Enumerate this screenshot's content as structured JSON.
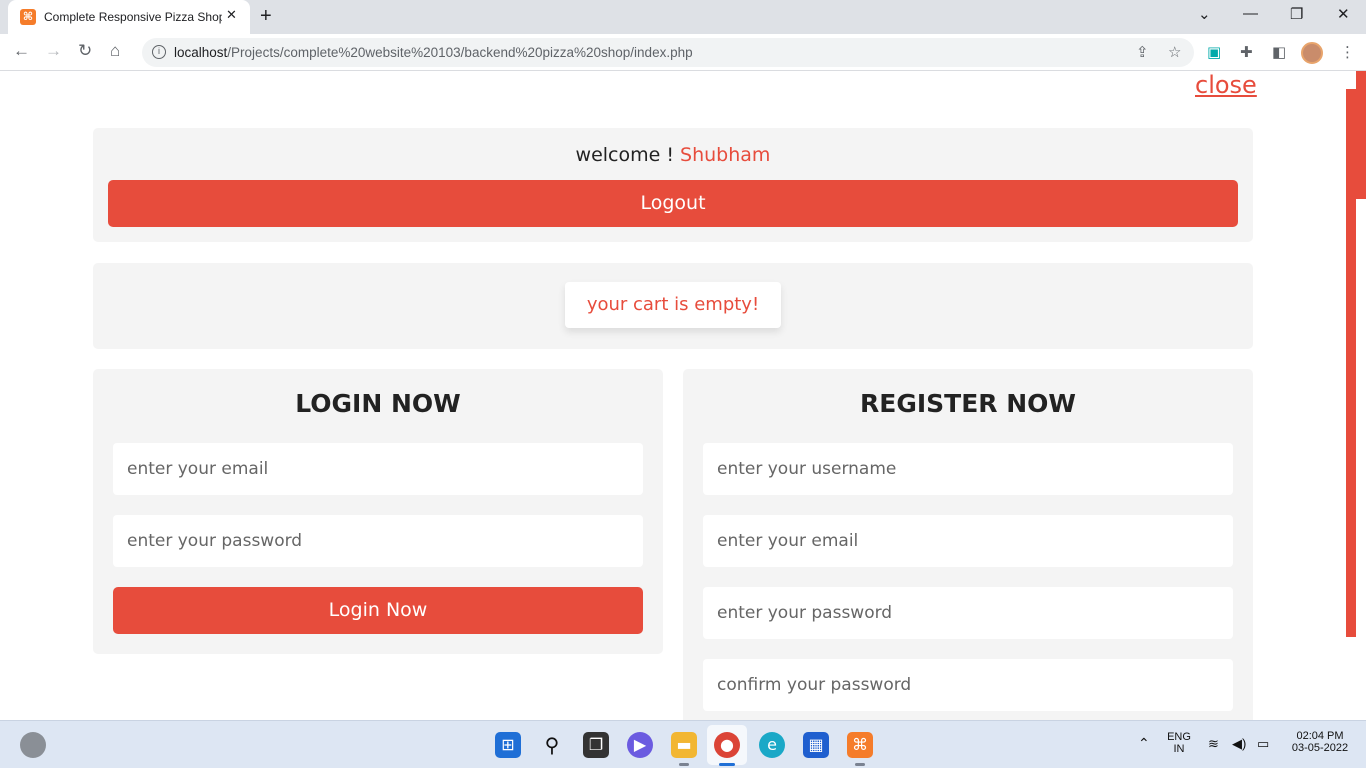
{
  "browser": {
    "tab_title": "Complete Responsive Pizza Shop",
    "tab_close": "✕",
    "new_tab": "+",
    "url_host": "localhost",
    "url_path": "/Projects/complete%20website%20103/backend%20pizza%20shop/index.php",
    "window_controls": [
      "⌄",
      "—",
      "❐",
      "✕"
    ]
  },
  "page": {
    "close_label": "close",
    "welcome_prefix": "welcome ! ",
    "welcome_name": "Shubham",
    "logout_label": "Logout",
    "cart_empty": "your cart is empty!",
    "login": {
      "title": "LOGIN NOW",
      "email_placeholder": "enter your email",
      "password_placeholder": "enter your password",
      "button": "Login Now"
    },
    "register": {
      "title": "REGISTER NOW",
      "username_placeholder": "enter your username",
      "email_placeholder": "enter your email",
      "password_placeholder": "enter your password",
      "confirm_placeholder": "confirm your password"
    },
    "accent_color": "#e74c3c"
  },
  "taskbar": {
    "lang_line1": "ENG",
    "lang_line2": "IN",
    "time": "02:04 PM",
    "date": "03-05-2022"
  }
}
